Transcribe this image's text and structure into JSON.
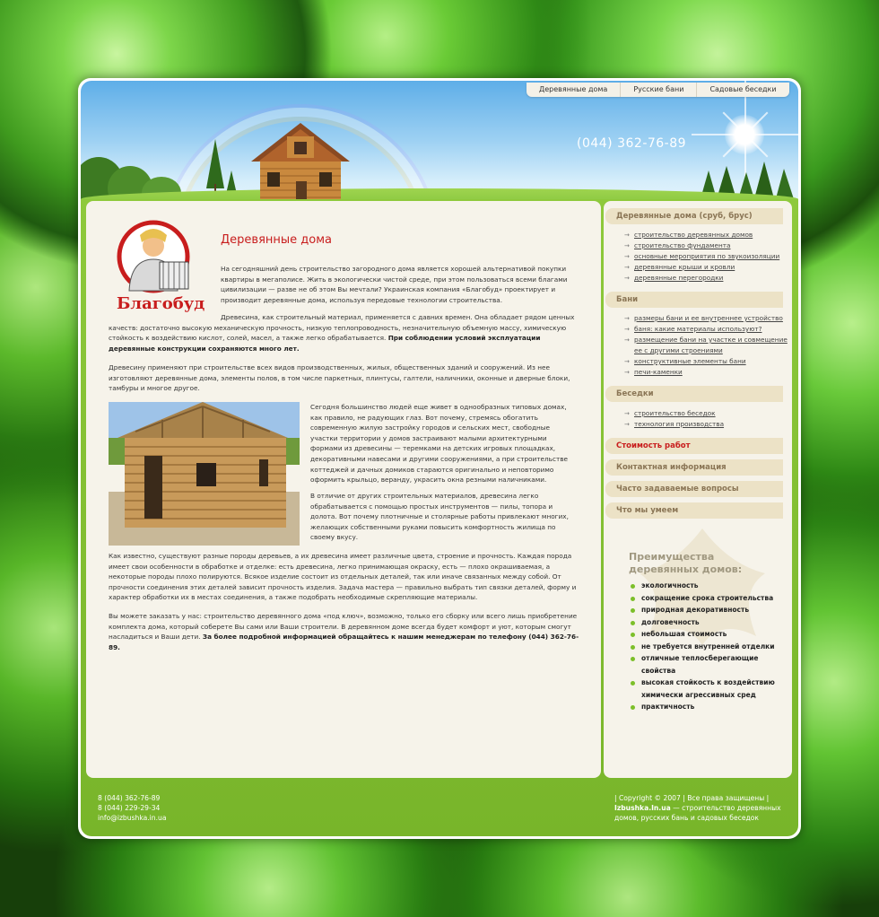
{
  "topnav": [
    "Деревянные дома",
    "Русские бани",
    "Садовые беседки"
  ],
  "header_phone": "(044) 362-76-89",
  "logo_text": "Благобуд",
  "page_title": "Деревянные дома",
  "paragraphs": {
    "p1": "На сегодняшний день строительство загородного дома является хорошей альтернативой покупки квартиры в мегаполисе. Жить в экологически чистой среде, при этом пользоваться всеми благами цивилизации — разве не об этом Вы мечтали? Украинская компания «Благобуд» проектирует и производит деревянные дома, используя передовые технологии строительства.",
    "p2": "Древесина, как строительный материал, применяется с давних времен. Она обладает рядом ценных качеств: достаточно высокую механическую прочность, низкую теплопроводность, незначительную объемную массу, химическую стойкость к воздействию кислот, солей, масел, а также легко обрабатывается.",
    "p2_bold": "При соблюдении условий эксплуатации деревянные конструкции сохраняются много лет.",
    "p3": "Древесину применяют при строительстве всех видов производственных, жилых, общественных зданий и сооружений. Из нее изготовляют деревянные дома, элементы полов, в том числе паркетных, плинтусы, галтели, наличники, оконные и дверные блоки, тамбуры и многое другое.",
    "p4": "Сегодня большинство людей еще живет в однообразных типовых домах, как правило, не радующих глаз. Вот почему, стремясь обогатить современную жилую застройку городов и сельских мест, свободные участки территории у домов застраивают малыми архитектурными формами из древесины — теремками на детских игровых площадках, декоративными навесами и другими сооружениями, а при строительстве коттеджей и дачных домиков стараются оригинально и неповторимо оформить крыльцо, веранду, украсить окна резными наличниками.",
    "p5": "В отличие от других строительных материалов, древесина легко обрабатывается с помощью простых инструментов — пилы, топора и долота. Вот почему плотничные и столярные работы привлекают многих, желающих собственными руками повысить комфортность жилища по своему вкусу.",
    "p6": "Как известно, существуют разные породы деревьев, а их древесина имеет различные цвета, строение и прочность. Каждая порода имеет свои особенности в обработке и отделке: есть древесина, легко принимающая окраску, есть — плохо окрашиваемая, а некоторые породы плохо полируются. Всякое изделие состоит из отдельных деталей, так или иначе связанных между собой. От прочности соединения этих деталей зависит прочность изделия. Задача мастера — правильно выбрать тип связки деталей, форму и характер обработки их в местах соединения, а также подобрать необходимые скрепляющие материалы.",
    "p7": "Вы можете заказать у нас: строительство деревянного дома «под ключ», возможно, только его сборку или всего лишь приобретение комплекта дома, который соберете Вы сами или Ваши строители. В деревянном доме всегда будет комфорт и уют, которым смогут насладиться и Ваши дети.",
    "p7_bold": "За более подробной информацией обращайтесь к нашим менеджерам по телефону (044) 362-76-89."
  },
  "sidebar": {
    "sections": [
      {
        "title": "Деревянные дома (сруб, брус)",
        "items": [
          "строительство деревянных домов",
          "строительство фундамента",
          "основные мероприятия по звукоизоляции",
          "деревянные крыши и кровли",
          "деревянные перегородки"
        ]
      },
      {
        "title": "Бани",
        "items": [
          "размеры бани и ее внутреннее устройство",
          "баня: какие материалы используют?",
          "размещение бани на участке и совмещение ее с другими строениями",
          "конструктивные элементы бани",
          "печи-каменки"
        ]
      },
      {
        "title": "Беседки",
        "items": [
          "строительство беседок",
          "технология производства"
        ]
      }
    ],
    "links": [
      "Стоимость работ",
      "Контактная информация",
      "Часто задаваемые вопросы",
      "Что мы умеем"
    ],
    "advantages_title_1": "Преимущества",
    "advantages_title_2": "деревянных домов:",
    "advantages": [
      "экологичность",
      "сокращение срока строительства",
      "природная декоративность",
      "долговечность",
      "небольшая стоимость",
      "не требуется внутренней отделки",
      "отличные теплосберегающие свойства",
      "высокая стойкость к воздействию химически агрессивных сред",
      "практичность"
    ]
  },
  "footer": {
    "phone1": "8 (044) 362-76-89",
    "phone2": "8 (044) 229-29-34",
    "email": "info@izbushka.in.ua",
    "copyright": "| Copyright © 2007 | Все права защищены |",
    "site": "Izbushka.In.ua",
    "site_desc": " — строительство деревянных домов, русских бань и садовых беседок"
  },
  "colors": {
    "accent_red": "#c81d1d",
    "green": "#7cbf2a",
    "cream": "#f6f3ea",
    "tab": "#ece2c6"
  }
}
